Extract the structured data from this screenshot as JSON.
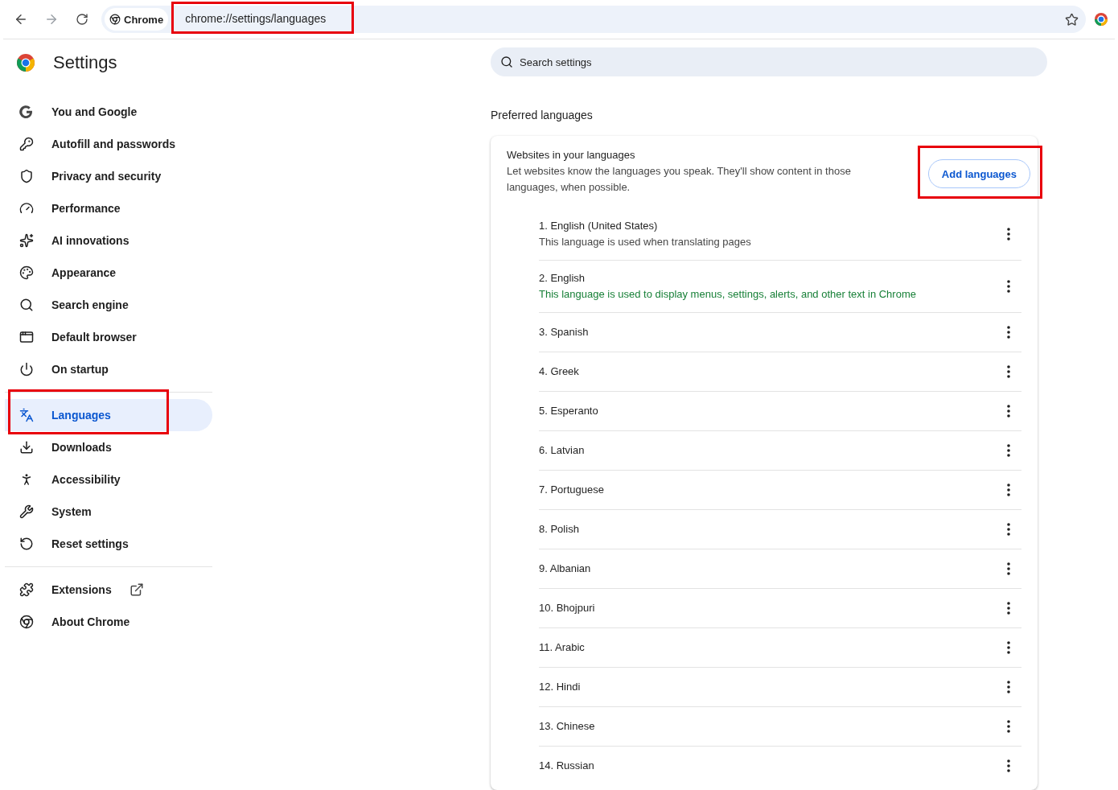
{
  "toolbar": {
    "site_chip": "Chrome",
    "url": "chrome://settings/languages",
    "url_highlighted": true
  },
  "header": {
    "title": "Settings",
    "search": {
      "placeholder": "Search settings"
    }
  },
  "sidebar": {
    "groups": [
      {
        "items": [
          {
            "label": "You and Google",
            "kind": "page",
            "selected": false,
            "highlighted": false
          },
          {
            "label": "Autofill and passwords",
            "kind": "page",
            "selected": false,
            "highlighted": false
          },
          {
            "label": "Privacy and security",
            "kind": "page",
            "selected": false,
            "highlighted": false
          },
          {
            "label": "Performance",
            "kind": "page",
            "selected": false,
            "highlighted": false
          },
          {
            "label": "AI innovations",
            "kind": "page",
            "selected": false,
            "highlighted": false
          },
          {
            "label": "Appearance",
            "kind": "page",
            "selected": false,
            "highlighted": false
          },
          {
            "label": "Search engine",
            "kind": "page",
            "selected": false,
            "highlighted": false
          },
          {
            "label": "Default browser",
            "kind": "page",
            "selected": false,
            "highlighted": false
          },
          {
            "label": "On startup",
            "kind": "page",
            "selected": false,
            "highlighted": false
          }
        ]
      },
      {
        "items": [
          {
            "label": "Languages",
            "kind": "page",
            "selected": true,
            "highlighted": true
          },
          {
            "label": "Downloads",
            "kind": "page",
            "selected": false,
            "highlighted": false
          },
          {
            "label": "Accessibility",
            "kind": "page",
            "selected": false,
            "highlighted": false
          },
          {
            "label": "System",
            "kind": "page",
            "selected": false,
            "highlighted": false
          },
          {
            "label": "Reset settings",
            "kind": "page",
            "selected": false,
            "highlighted": false
          }
        ]
      },
      {
        "items": [
          {
            "label": "Extensions",
            "kind": "external",
            "selected": false,
            "highlighted": false
          },
          {
            "label": "About Chrome",
            "kind": "page",
            "selected": false,
            "highlighted": false
          }
        ]
      }
    ]
  },
  "section": {
    "heading": "Preferred languages",
    "card": {
      "title": "Websites in your languages",
      "description": "Let websites know the languages you speak. They'll show content in those languages, when possible.",
      "add_button": "Add languages",
      "add_button_highlighted": true,
      "languages": [
        {
          "name": "1. English (United States)",
          "note": "This language is used when translating pages",
          "kind": "translation"
        },
        {
          "name": "2. English",
          "note": "This language is used to display menus, settings, alerts, and other text in Chrome",
          "kind": "display"
        },
        {
          "name": "3. Spanish"
        },
        {
          "name": "4. Greek"
        },
        {
          "name": "5. Esperanto"
        },
        {
          "name": "6. Latvian"
        },
        {
          "name": "7. Portuguese"
        },
        {
          "name": "8. Polish"
        },
        {
          "name": "9. Albanian"
        },
        {
          "name": "10. Bhojpuri"
        },
        {
          "name": "11. Arabic"
        },
        {
          "name": "12. Hindi"
        },
        {
          "name": "13. Chinese"
        },
        {
          "name": "14. Russian"
        }
      ]
    }
  }
}
